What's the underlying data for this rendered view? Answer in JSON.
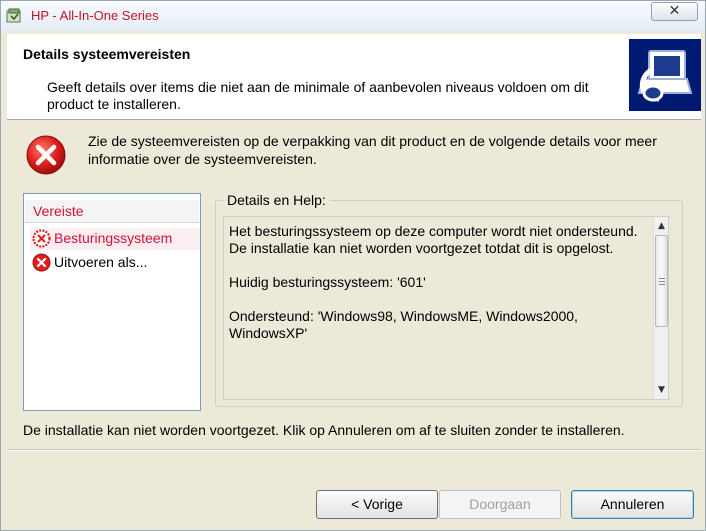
{
  "window": {
    "title": "HP - All-In-One Series",
    "close_label": "✕"
  },
  "header": {
    "title": "Details systeemvereisten",
    "subtitle": "Geeft details over items die niet aan de minimale of aanbevolen niveaus voldoen om dit product te installeren."
  },
  "warning": {
    "text": "Zie de systeemvereisten op de verpakking van dit product en de volgende details voor meer informatie over de systeemvereisten."
  },
  "requirements": {
    "header": "Vereiste",
    "items": [
      {
        "label": "Besturingssysteem",
        "selected": true
      },
      {
        "label": "Uitvoeren als...",
        "selected": false
      }
    ]
  },
  "details": {
    "legend": "Details en Help:",
    "paragraphs": [
      "Het besturingssysteem op deze computer wordt niet ondersteund. De installatie kan niet worden voortgezet totdat dit is opgelost.",
      "Huidig besturingssysteem: '601'",
      "Ondersteund: 'Windows98, WindowsME, Windows2000, WindowsXP'"
    ]
  },
  "status": {
    "text": "De installatie kan niet worden voortgezet. Klik op Annuleren om af te sluiten zonder te installeren."
  },
  "buttons": {
    "back": "< Vorige",
    "next": "Doorgaan",
    "cancel": "Annuleren"
  },
  "colors": {
    "accent_red": "#d0103a",
    "error_red": "#e0201f",
    "logo_blue": "#001a72"
  }
}
